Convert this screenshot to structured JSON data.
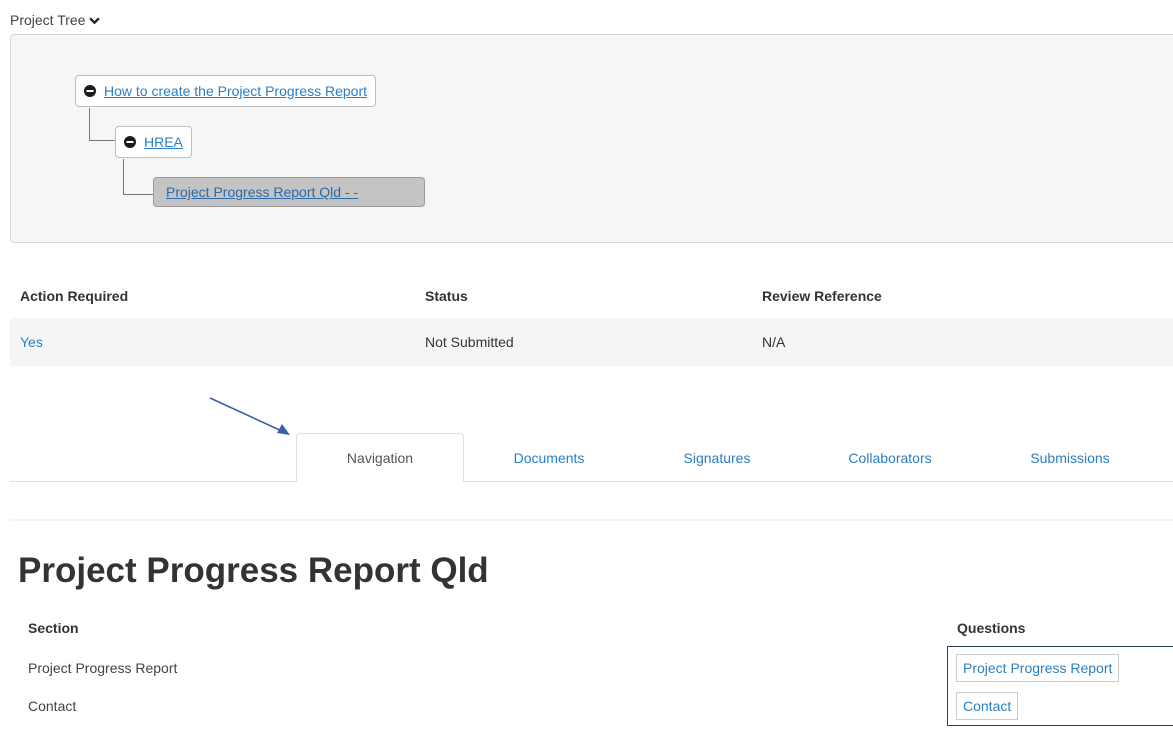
{
  "project_tree": {
    "toggle_label": "Project Tree",
    "nodes": [
      {
        "label": "How to create the Project Progress Report"
      },
      {
        "label": "HREA"
      },
      {
        "label": "Project Progress Report Qld - -"
      }
    ]
  },
  "status_table": {
    "headers": [
      "Action Required",
      "Status",
      "Review Reference"
    ],
    "row": [
      "Yes",
      "Not Submitted",
      "N/A"
    ]
  },
  "tabs": [
    {
      "label": "Navigation",
      "active": true
    },
    {
      "label": "Documents"
    },
    {
      "label": "Signatures"
    },
    {
      "label": "Collaborators"
    },
    {
      "label": "Submissions"
    }
  ],
  "page": {
    "title": "Project Progress Report Qld",
    "section_header": "Section",
    "questions_header": "Questions",
    "sections": [
      "Project Progress Report",
      "Contact"
    ],
    "questions": [
      "Project Progress Report",
      "Contact"
    ]
  },
  "colors": {
    "link": "#2a7fc4",
    "selected_node": "#c4c4c4",
    "arrow": "#3b5ea8",
    "questions_border": "#2c3e66"
  }
}
